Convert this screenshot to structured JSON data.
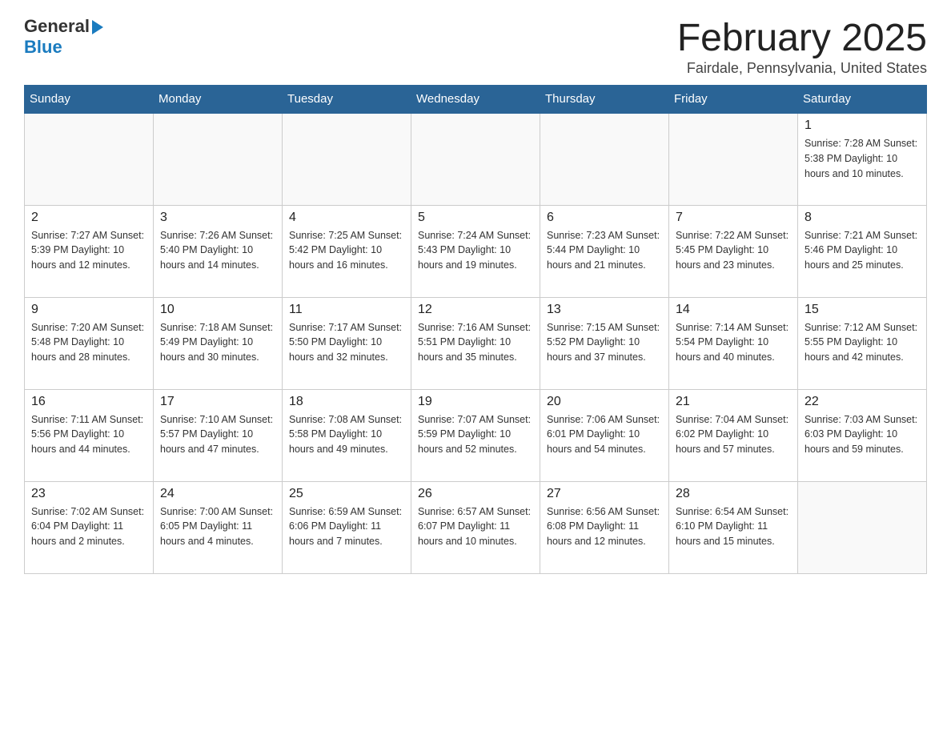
{
  "header": {
    "logo_general": "General",
    "logo_blue": "Blue",
    "month_title": "February 2025",
    "location": "Fairdale, Pennsylvania, United States"
  },
  "days_of_week": [
    "Sunday",
    "Monday",
    "Tuesday",
    "Wednesday",
    "Thursday",
    "Friday",
    "Saturday"
  ],
  "weeks": [
    [
      {
        "day": "",
        "info": ""
      },
      {
        "day": "",
        "info": ""
      },
      {
        "day": "",
        "info": ""
      },
      {
        "day": "",
        "info": ""
      },
      {
        "day": "",
        "info": ""
      },
      {
        "day": "",
        "info": ""
      },
      {
        "day": "1",
        "info": "Sunrise: 7:28 AM\nSunset: 5:38 PM\nDaylight: 10 hours\nand 10 minutes."
      }
    ],
    [
      {
        "day": "2",
        "info": "Sunrise: 7:27 AM\nSunset: 5:39 PM\nDaylight: 10 hours\nand 12 minutes."
      },
      {
        "day": "3",
        "info": "Sunrise: 7:26 AM\nSunset: 5:40 PM\nDaylight: 10 hours\nand 14 minutes."
      },
      {
        "day": "4",
        "info": "Sunrise: 7:25 AM\nSunset: 5:42 PM\nDaylight: 10 hours\nand 16 minutes."
      },
      {
        "day": "5",
        "info": "Sunrise: 7:24 AM\nSunset: 5:43 PM\nDaylight: 10 hours\nand 19 minutes."
      },
      {
        "day": "6",
        "info": "Sunrise: 7:23 AM\nSunset: 5:44 PM\nDaylight: 10 hours\nand 21 minutes."
      },
      {
        "day": "7",
        "info": "Sunrise: 7:22 AM\nSunset: 5:45 PM\nDaylight: 10 hours\nand 23 minutes."
      },
      {
        "day": "8",
        "info": "Sunrise: 7:21 AM\nSunset: 5:46 PM\nDaylight: 10 hours\nand 25 minutes."
      }
    ],
    [
      {
        "day": "9",
        "info": "Sunrise: 7:20 AM\nSunset: 5:48 PM\nDaylight: 10 hours\nand 28 minutes."
      },
      {
        "day": "10",
        "info": "Sunrise: 7:18 AM\nSunset: 5:49 PM\nDaylight: 10 hours\nand 30 minutes."
      },
      {
        "day": "11",
        "info": "Sunrise: 7:17 AM\nSunset: 5:50 PM\nDaylight: 10 hours\nand 32 minutes."
      },
      {
        "day": "12",
        "info": "Sunrise: 7:16 AM\nSunset: 5:51 PM\nDaylight: 10 hours\nand 35 minutes."
      },
      {
        "day": "13",
        "info": "Sunrise: 7:15 AM\nSunset: 5:52 PM\nDaylight: 10 hours\nand 37 minutes."
      },
      {
        "day": "14",
        "info": "Sunrise: 7:14 AM\nSunset: 5:54 PM\nDaylight: 10 hours\nand 40 minutes."
      },
      {
        "day": "15",
        "info": "Sunrise: 7:12 AM\nSunset: 5:55 PM\nDaylight: 10 hours\nand 42 minutes."
      }
    ],
    [
      {
        "day": "16",
        "info": "Sunrise: 7:11 AM\nSunset: 5:56 PM\nDaylight: 10 hours\nand 44 minutes."
      },
      {
        "day": "17",
        "info": "Sunrise: 7:10 AM\nSunset: 5:57 PM\nDaylight: 10 hours\nand 47 minutes."
      },
      {
        "day": "18",
        "info": "Sunrise: 7:08 AM\nSunset: 5:58 PM\nDaylight: 10 hours\nand 49 minutes."
      },
      {
        "day": "19",
        "info": "Sunrise: 7:07 AM\nSunset: 5:59 PM\nDaylight: 10 hours\nand 52 minutes."
      },
      {
        "day": "20",
        "info": "Sunrise: 7:06 AM\nSunset: 6:01 PM\nDaylight: 10 hours\nand 54 minutes."
      },
      {
        "day": "21",
        "info": "Sunrise: 7:04 AM\nSunset: 6:02 PM\nDaylight: 10 hours\nand 57 minutes."
      },
      {
        "day": "22",
        "info": "Sunrise: 7:03 AM\nSunset: 6:03 PM\nDaylight: 10 hours\nand 59 minutes."
      }
    ],
    [
      {
        "day": "23",
        "info": "Sunrise: 7:02 AM\nSunset: 6:04 PM\nDaylight: 11 hours\nand 2 minutes."
      },
      {
        "day": "24",
        "info": "Sunrise: 7:00 AM\nSunset: 6:05 PM\nDaylight: 11 hours\nand 4 minutes."
      },
      {
        "day": "25",
        "info": "Sunrise: 6:59 AM\nSunset: 6:06 PM\nDaylight: 11 hours\nand 7 minutes."
      },
      {
        "day": "26",
        "info": "Sunrise: 6:57 AM\nSunset: 6:07 PM\nDaylight: 11 hours\nand 10 minutes."
      },
      {
        "day": "27",
        "info": "Sunrise: 6:56 AM\nSunset: 6:08 PM\nDaylight: 11 hours\nand 12 minutes."
      },
      {
        "day": "28",
        "info": "Sunrise: 6:54 AM\nSunset: 6:10 PM\nDaylight: 11 hours\nand 15 minutes."
      },
      {
        "day": "",
        "info": ""
      }
    ]
  ]
}
